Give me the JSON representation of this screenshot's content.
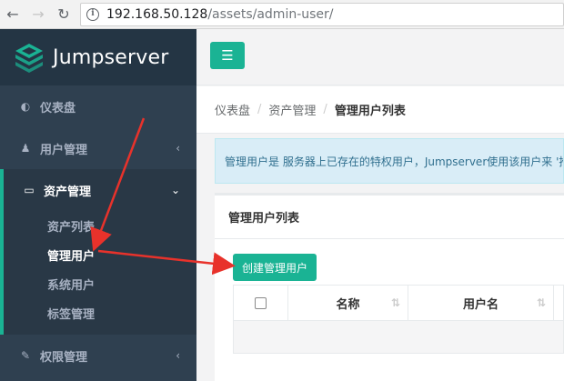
{
  "browser": {
    "url_host": "192.168.50.128",
    "url_path": "/assets/admin-user/"
  },
  "brand": {
    "name": "Jumpserver"
  },
  "sidebar": {
    "items": [
      {
        "label": "仪表盘",
        "icon": "dashboard-icon"
      },
      {
        "label": "用户管理",
        "icon": "users-icon"
      },
      {
        "label": "资产管理",
        "icon": "hdd-icon",
        "active": true,
        "children": [
          {
            "label": "资产列表"
          },
          {
            "label": "管理用户",
            "current": true
          },
          {
            "label": "系统用户"
          },
          {
            "label": "标签管理"
          }
        ]
      },
      {
        "label": "权限管理",
        "icon": "edit-icon"
      }
    ]
  },
  "breadcrumb": [
    "仪表盘",
    "资产管理",
    "管理用户列表"
  ],
  "alert": {
    "text": "管理用户是 服务器上已存在的特权用户，Jumpserver使用该用户来 '推"
  },
  "panel": {
    "title": "管理用户列表",
    "create_button": "创建管理用户",
    "columns": [
      "名称",
      "用户名"
    ]
  },
  "colors": {
    "accent": "#1ab394",
    "sidebar": "#2f4050",
    "annotation": "#e8322b"
  }
}
